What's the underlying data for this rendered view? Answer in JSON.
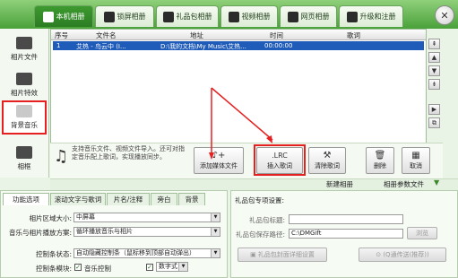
{
  "top_tabs": [
    {
      "label": "本机相册",
      "active": true
    },
    {
      "label": "锁屏相册",
      "active": false
    },
    {
      "label": "礼品包相册",
      "active": false
    },
    {
      "label": "视频相册",
      "active": false
    },
    {
      "label": "网页相册",
      "active": false
    },
    {
      "label": "升级和注册",
      "active": false
    }
  ],
  "sidebar": {
    "items": [
      {
        "label": "相片文件",
        "icon": "camera-icon"
      },
      {
        "label": "相片特效",
        "icon": "effects-icon"
      },
      {
        "label": "背景音乐",
        "icon": "music-icon",
        "selected": true
      },
      {
        "label": "相框",
        "icon": "frame-icon"
      }
    ]
  },
  "table": {
    "headers": [
      "序号",
      "文件名",
      "地址",
      "时间",
      "歌词"
    ],
    "rows": [
      {
        "index": "1",
        "filename": "艾热 - 鸟云中 (I...",
        "path": "D:\\我的文档\\My Music\\艾热...",
        "time": "00:00:00",
        "lyrics": ""
      }
    ]
  },
  "scroll_buttons": [
    "⇞",
    "▲",
    "▼",
    "⇟",
    "▶",
    "⧉"
  ],
  "toolbar": {
    "hint": "支持音乐文件、视频文件导入。还可对指定音乐配上歌词，实现播放同步。",
    "add_media": "添加媒体文件",
    "insert_lyrics": "插入歌词",
    "lrc_icon_text": ".LRC",
    "clear_lyrics": "清除歌词",
    "delete": "删除",
    "cancel": "取消"
  },
  "bottom_bar": {
    "new_album": "新建相册",
    "album_params": "相册参数文件"
  },
  "options": {
    "tabs": [
      "功能选项",
      "滚动文字与歌词",
      "片名/注释",
      "旁白",
      "背景"
    ],
    "area_size_label": "相片区域大小:",
    "area_size_value": "中屏幕",
    "loop_label": "音乐与相片播放方案:",
    "loop_value": "循环播放音乐与相片",
    "control_label": "控制条状态:",
    "control_value": "自动隐藏控制条（鼠标移到顶部自动弹出）",
    "module_label": "控制条模块:",
    "music_control": "音乐控制",
    "digital": "数字式"
  },
  "gift": {
    "title": "礼品包专项设置:",
    "name_label": "礼品包标题:",
    "path_label": "礼品包保存路径:",
    "path_value": "C:\\DMGift",
    "browse": "浏览",
    "detail_btn": "礼品包封面详细设置",
    "send_btn": "(Q通传送(推荐))"
  }
}
